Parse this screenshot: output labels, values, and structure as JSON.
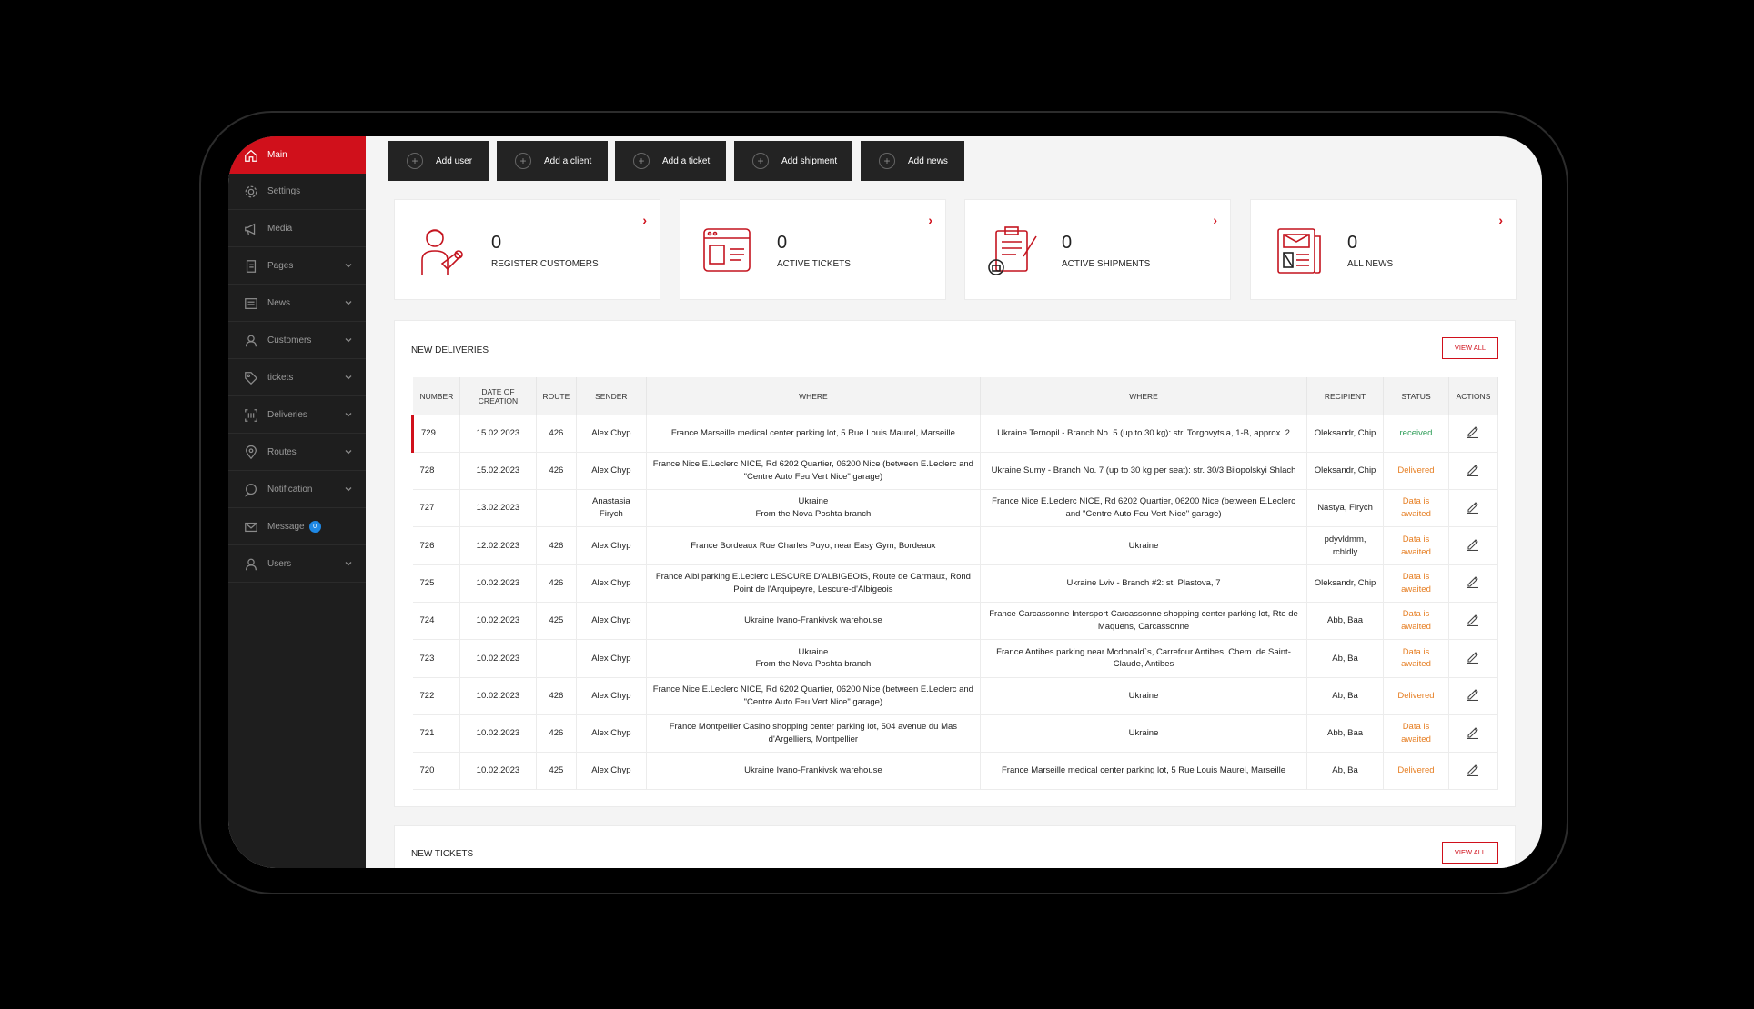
{
  "sidebar": {
    "items": [
      {
        "label": "Main",
        "icon": "home-icon",
        "active": true,
        "has_submenu": false
      },
      {
        "label": "Settings",
        "icon": "gear-icon",
        "has_submenu": false
      },
      {
        "label": "Media",
        "icon": "megaphone-icon",
        "has_submenu": false
      },
      {
        "label": "Pages",
        "icon": "pages-icon",
        "has_submenu": true
      },
      {
        "label": "News",
        "icon": "newspaper-icon",
        "has_submenu": true
      },
      {
        "label": "Customers",
        "icon": "user-icon",
        "has_submenu": true
      },
      {
        "label": "tickets",
        "icon": "tag-icon",
        "has_submenu": true
      },
      {
        "label": "Deliveries",
        "icon": "barcode-icon",
        "has_submenu": true
      },
      {
        "label": "Routes",
        "icon": "map-pin-icon",
        "has_submenu": true
      },
      {
        "label": "Notification",
        "icon": "chat-icon",
        "has_submenu": true
      },
      {
        "label": "Message",
        "icon": "mail-icon",
        "badge": "0",
        "has_submenu": false
      },
      {
        "label": "Users",
        "icon": "user-icon",
        "has_submenu": true
      }
    ]
  },
  "quick_actions": [
    {
      "label": "Add user"
    },
    {
      "label": "Add a client"
    },
    {
      "label": "Add a ticket"
    },
    {
      "label": "Add shipment"
    },
    {
      "label": "Add news"
    }
  ],
  "stats": [
    {
      "value": "0",
      "label": "REGISTER CUSTOMERS",
      "icon": "courier-icon"
    },
    {
      "value": "0",
      "label": "ACTIVE TICKETS",
      "icon": "ticket-window-icon"
    },
    {
      "value": "0",
      "label": "ACTIVE SHIPMENTS",
      "icon": "clipboard-icon"
    },
    {
      "value": "0",
      "label": "ALL NEWS",
      "icon": "newspaper-icon"
    }
  ],
  "deliveries": {
    "title": "NEW DELIVERIES",
    "view_all": "VIEW ALL",
    "columns": [
      "NUMBER",
      "DATE OF CREATION",
      "ROUTE",
      "SENDER",
      "WHERE",
      "WHERE",
      "RECIPIENT",
      "STATUS",
      "ACTIONS"
    ],
    "rows": [
      {
        "number": "729",
        "date": "15.02.2023",
        "route": "426",
        "sender": "Alex Chyp",
        "from": "France Marseille medical center parking lot, 5 Rue Louis Maurel, Marseille",
        "to": "Ukraine  Ternopil - Branch No. 5 (up to 30 kg): str. Torgovytsia, 1-B, approx. 2",
        "recipient": "Oleksandr, Chip",
        "status": "received",
        "status_class": "st-received"
      },
      {
        "number": "728",
        "date": "15.02.2023",
        "route": "426",
        "sender": "Alex Chyp",
        "from": "France Nice E.Leclerc NICE, Rd 6202 Quartier, 06200 Nice (between E.Leclerc and \"Centre Auto Feu Vert Nice\" garage)",
        "to": "Ukraine  Sumy - Branch No. 7 (up to 30 kg per seat): str. 30/3 Bilopolskyi Shlach",
        "recipient": "Oleksandr, Chip",
        "status": "Delivered",
        "status_class": "st-delivered"
      },
      {
        "number": "727",
        "date": "13.02.2023",
        "route": "",
        "sender": "Anastasia Firych",
        "from": "Ukraine\nFrom the Nova Poshta branch",
        "to": "France  Nice E.Leclerc NICE, Rd 6202 Quartier, 06200 Nice (between E.Leclerc and \"Centre Auto Feu Vert Nice\" garage)",
        "recipient": "Nastya, Firych",
        "status": "Data is awaited",
        "status_class": "st-awaited"
      },
      {
        "number": "726",
        "date": "12.02.2023",
        "route": "426",
        "sender": "Alex Chyp",
        "from": "France Bordeaux Rue Charles Puyo, near Easy Gym, Bordeaux",
        "to": "Ukraine",
        "recipient": "pdyvldmm, rchldly",
        "status": "Data is awaited",
        "status_class": "st-awaited"
      },
      {
        "number": "725",
        "date": "10.02.2023",
        "route": "426",
        "sender": "Alex Chyp",
        "from": "France Albi parking E.Leclerc LESCURE D'ALBIGEOIS, Route de Carmaux, Rond Point de l'Arquipeyre, Lescure-d'Albigeois",
        "to": "Ukraine  Lviv - Branch #2: st. Plastova, 7",
        "recipient": "Oleksandr, Chip",
        "status": "Data is awaited",
        "status_class": "st-awaited"
      },
      {
        "number": "724",
        "date": "10.02.2023",
        "route": "425",
        "sender": "Alex Chyp",
        "from": "Ukraine Ivano-Frankivsk warehouse",
        "to": "France  Carcassonne Intersport Carcassonne shopping center parking lot, Rte de Maquens, Carcassonne",
        "recipient": "Abb, Baa",
        "status": "Data is awaited",
        "status_class": "st-awaited"
      },
      {
        "number": "723",
        "date": "10.02.2023",
        "route": "",
        "sender": "Alex Chyp",
        "from": "Ukraine\nFrom the Nova Poshta branch",
        "to": "France  Antibes parking near Mcdonald`s, Carrefour Antibes, Chem. de Saint-Claude, Antibes",
        "recipient": "Ab, Ba",
        "status": "Data is awaited",
        "status_class": "st-awaited"
      },
      {
        "number": "722",
        "date": "10.02.2023",
        "route": "426",
        "sender": "Alex Chyp",
        "from": "France Nice E.Leclerc NICE, Rd 6202 Quartier, 06200 Nice (between E.Leclerc and \"Centre Auto Feu Vert Nice\" garage)",
        "to": "Ukraine",
        "recipient": "Ab, Ba",
        "status": "Delivered",
        "status_class": "st-delivered"
      },
      {
        "number": "721",
        "date": "10.02.2023",
        "route": "426",
        "sender": "Alex Chyp",
        "from": "France Montpellier Casino shopping center parking lot, 504 avenue du Mas d'Argelliers, Montpellier",
        "to": "Ukraine",
        "recipient": "Abb, Baa",
        "status": "Data is awaited",
        "status_class": "st-awaited"
      },
      {
        "number": "720",
        "date": "10.02.2023",
        "route": "425",
        "sender": "Alex Chyp",
        "from": "Ukraine Ivano-Frankivsk warehouse",
        "to": "France  Marseille medical center parking lot, 5 Rue Louis Maurel, Marseille",
        "recipient": "Ab, Ba",
        "status": "Delivered",
        "status_class": "st-delivered"
      }
    ]
  },
  "tickets": {
    "title": "NEW TICKETS",
    "view_all": "VIEW ALL"
  }
}
